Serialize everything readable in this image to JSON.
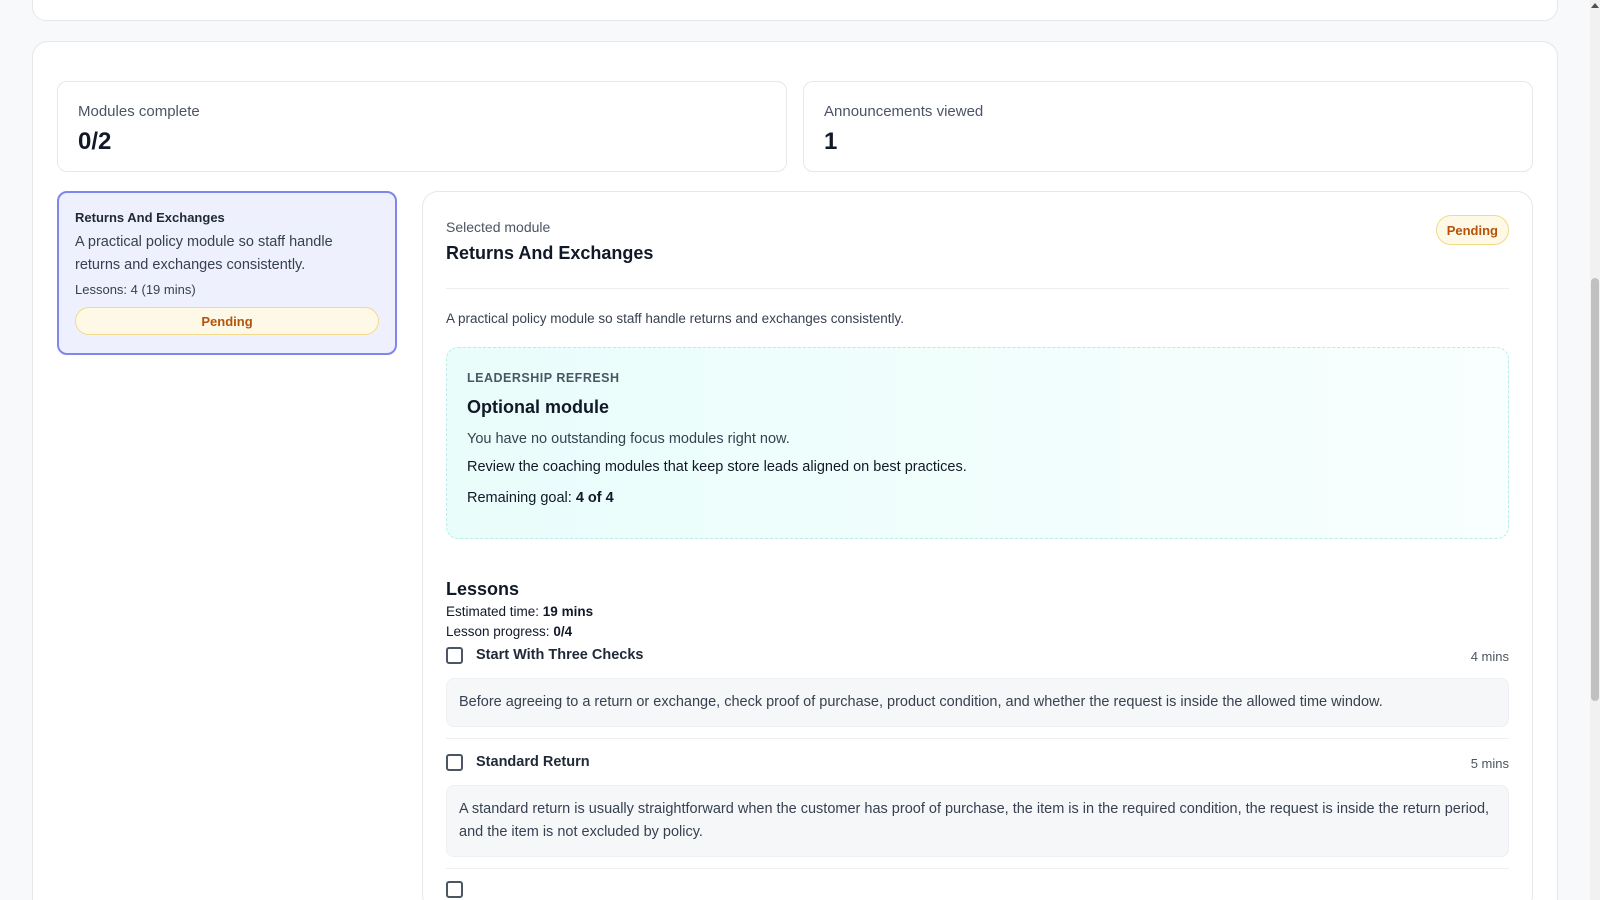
{
  "stats": {
    "modules_complete": {
      "label": "Modules complete",
      "value": "0/2"
    },
    "announcements_viewed": {
      "label": "Announcements viewed",
      "value": "1"
    }
  },
  "module_list": [
    {
      "title": "Returns And Exchanges",
      "description": "A practical policy module so staff handle returns and exchanges consistently.",
      "meta": "Lessons: 4 (19 mins)",
      "status": "Pending"
    }
  ],
  "selected": {
    "label": "Selected module",
    "title": "Returns And Exchanges",
    "status": "Pending",
    "description": "A practical policy module so staff handle returns and exchanges consistently."
  },
  "callout": {
    "eyebrow": "LEADERSHIP REFRESH",
    "title": "Optional module",
    "note": "You have no outstanding focus modules right now.",
    "text": "Review the coaching modules that keep store leads aligned on best practices.",
    "goal_label": "Remaining goal:",
    "goal_value": "4 of 4"
  },
  "lessons": {
    "title": "Lessons",
    "time_label": "Estimated time:",
    "time_value": "19 mins",
    "progress_label": "Lesson progress:",
    "progress_value": "0/4",
    "items": [
      {
        "name": "Start With Three Checks",
        "duration": "4 mins",
        "checked": false,
        "body": "Before agreeing to a return or exchange, check proof of purchase, product condition, and whether the request is inside the allowed time window."
      },
      {
        "name": "Standard Return",
        "duration": "5 mins",
        "checked": false,
        "body": "A standard return is usually straightforward when the customer has proof of purchase, the item is in the required condition, the request is inside the return period, and the item is not excluded by policy."
      }
    ]
  },
  "colors": {
    "accent": "#7f86ec",
    "pending_bg": "#fef8e6",
    "pending_text": "#b45309",
    "callout_bg": "#e9fdfb"
  }
}
